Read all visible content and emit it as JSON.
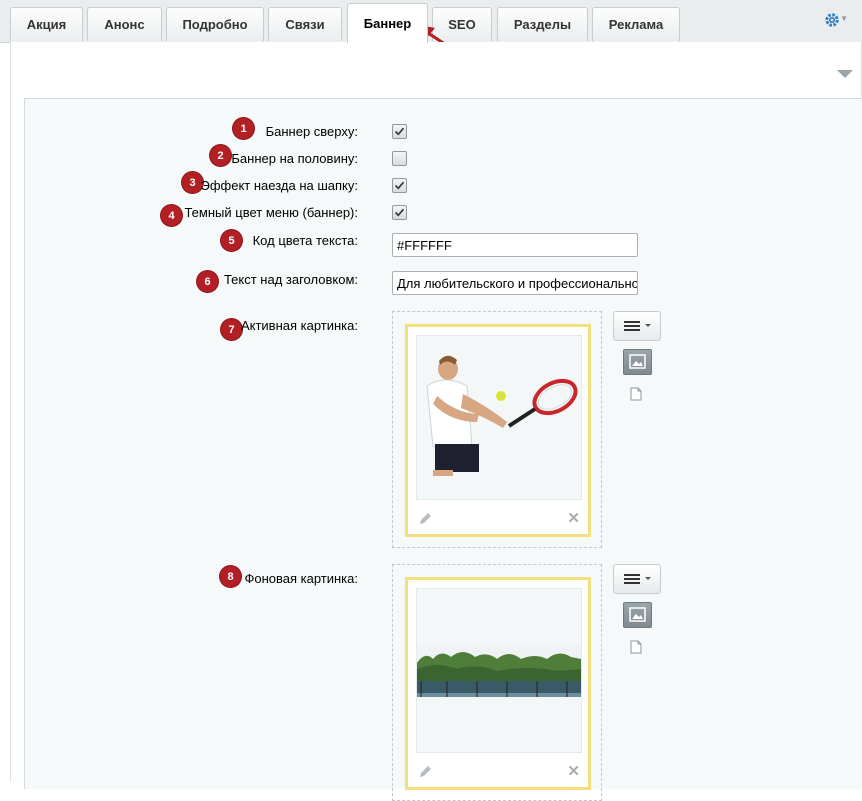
{
  "tabs": [
    {
      "label": "Акция",
      "active": false
    },
    {
      "label": "Анонс",
      "active": false
    },
    {
      "label": "Подробно",
      "active": false
    },
    {
      "label": "Связи",
      "active": false
    },
    {
      "label": "Баннер",
      "active": true
    },
    {
      "label": "SEO",
      "active": false
    },
    {
      "label": "Разделы",
      "active": false
    },
    {
      "label": "Реклама",
      "active": false
    }
  ],
  "header": {
    "settings_icon": "gear-icon",
    "collapse_icon": "triangle-down-icon"
  },
  "fields": [
    {
      "num": "1",
      "label": "Баннер сверху:",
      "type": "checkbox",
      "checked": true
    },
    {
      "num": "2",
      "label": "Баннер на половину:",
      "type": "checkbox",
      "checked": false
    },
    {
      "num": "3",
      "label": "Эффект наезда на шапку:",
      "type": "checkbox",
      "checked": true
    },
    {
      "num": "4",
      "label": "Темный цвет меню (баннер):",
      "type": "checkbox",
      "checked": true
    },
    {
      "num": "5",
      "label": "Код цвета текста:",
      "type": "text",
      "value": "#FFFFFF"
    },
    {
      "num": "6",
      "label": "Текст над заголовком:",
      "type": "text",
      "value": "Для любительского и профессионального"
    },
    {
      "num": "7",
      "label": "Активная картинка:",
      "type": "image",
      "image": "tennis-player-photo"
    },
    {
      "num": "8",
      "label": "Фоновая картинка:",
      "type": "image",
      "image": "tennis-courts-photo"
    }
  ],
  "colors": {
    "badge": "#b21f24",
    "arrow": "#b21f24",
    "frame": "#f4df7e",
    "gear": "#2f7dc2"
  }
}
